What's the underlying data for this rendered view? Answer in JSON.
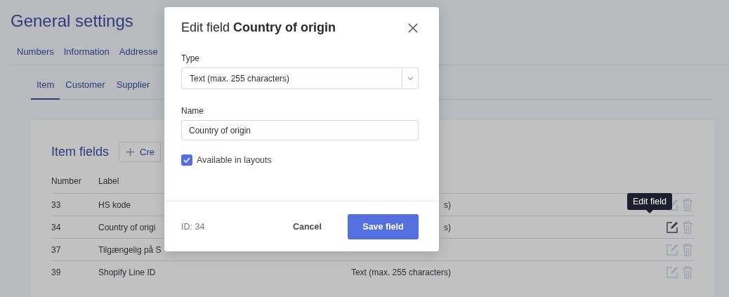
{
  "page": {
    "title": "General settings"
  },
  "nav_tabs": [
    {
      "label": "Numbers"
    },
    {
      "label": "Information"
    },
    {
      "label": "Addresse"
    }
  ],
  "sub_tabs": [
    {
      "label": "Item",
      "selected": true
    },
    {
      "label": "Customer",
      "selected": false
    },
    {
      "label": "Supplier",
      "selected": false
    }
  ],
  "card": {
    "title": "Item fields",
    "create_button": "Cre",
    "columns": [
      "Number",
      "Label"
    ],
    "rows": [
      {
        "number": "33",
        "label": "HS kode",
        "type": "s)",
        "edit_hovered": false
      },
      {
        "number": "34",
        "label": "Country of origi",
        "type": "s)",
        "edit_hovered": true
      },
      {
        "number": "37",
        "label": "Tilgængelig på S",
        "edit_hovered": false
      },
      {
        "number": "39",
        "label": "Shopify Line ID",
        "type": "Text (max. 255 characters)",
        "edit_hovered": false
      }
    ]
  },
  "tooltip": "Edit field",
  "modal": {
    "title": "Edit field **Country of origin**",
    "type_label": "Type",
    "type_value": "Text (max. 255 characters)",
    "name_label": "Name",
    "name_value": "Country of origin",
    "available": {
      "label": "Available in layouts",
      "checked": true
    },
    "id_text": "ID: 34",
    "cancel": "Cancel",
    "save": "Save field"
  }
}
